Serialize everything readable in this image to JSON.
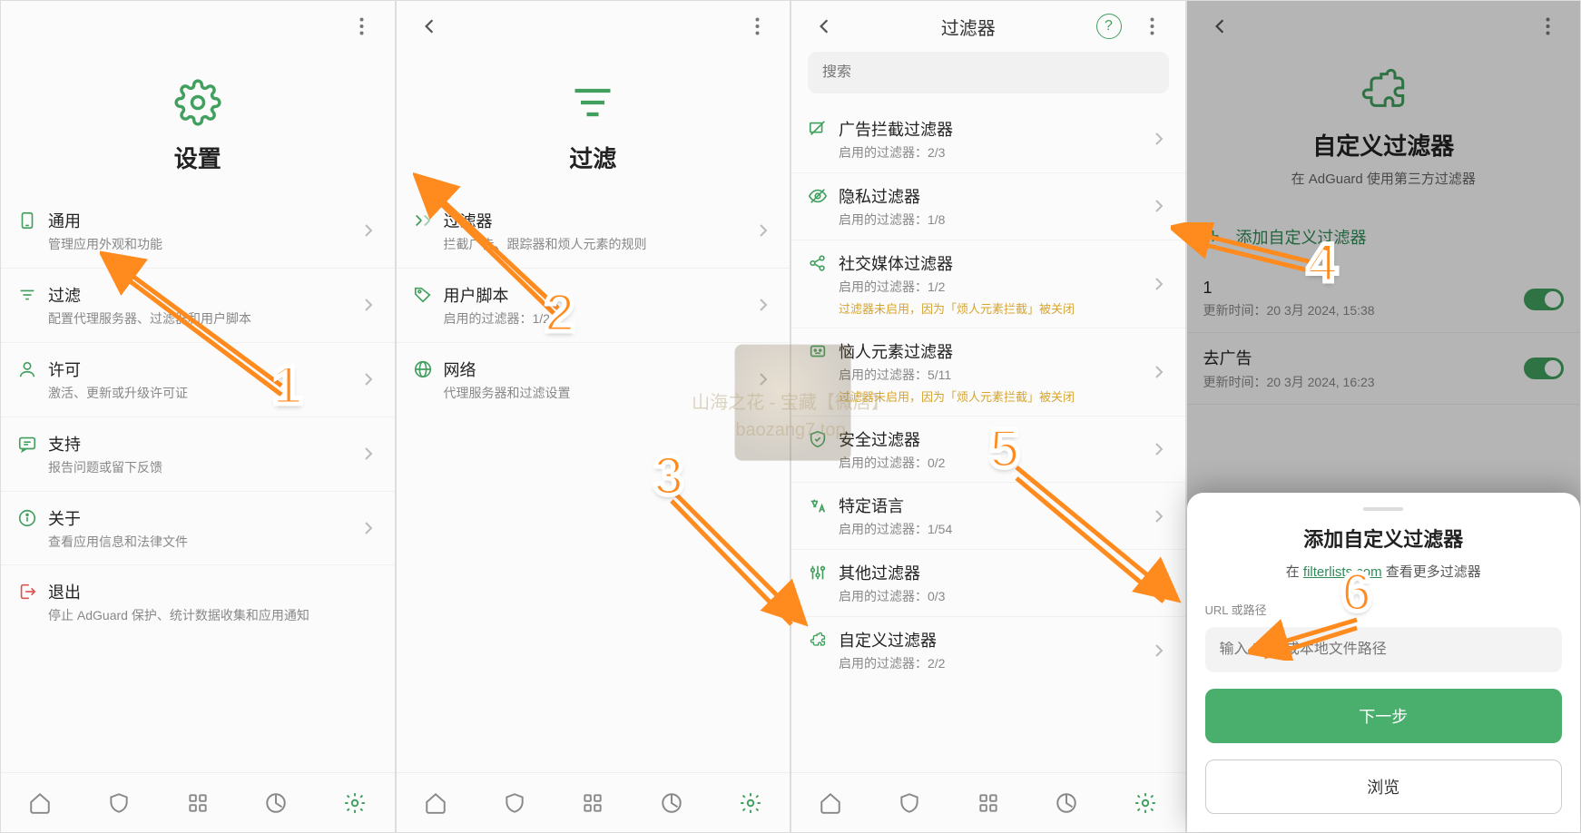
{
  "watermark": {
    "line1": "山海之花 - 宝藏【微店】",
    "line2": "baozang7.top"
  },
  "annotations": {
    "n1": "1",
    "n2": "2",
    "n3": "3",
    "n4": "4",
    "n5": "5",
    "n6": "6"
  },
  "pane1": {
    "hero_title": "设置",
    "items": [
      {
        "title": "通用",
        "sub": "管理应用外观和功能"
      },
      {
        "title": "过滤",
        "sub": "配置代理服务器、过滤器和用户脚本"
      },
      {
        "title": "许可",
        "sub": "激活、更新或升级许可证"
      },
      {
        "title": "支持",
        "sub": "报告问题或留下反馈"
      },
      {
        "title": "关于",
        "sub": "查看应用信息和法律文件"
      },
      {
        "title": "退出",
        "sub": "停止 AdGuard 保护、统计数据收集和应用通知"
      }
    ]
  },
  "pane2": {
    "hero_title": "过滤",
    "items": [
      {
        "title": "过滤器",
        "sub": "拦截广告、跟踪器和烦人元素的规则"
      },
      {
        "title": "用户脚本",
        "sub": "启用的过滤器：1/2"
      },
      {
        "title": "网络",
        "sub": "代理服务器和过滤设置"
      }
    ]
  },
  "pane3": {
    "title": "过滤器",
    "search_placeholder": "搜索",
    "items": [
      {
        "title": "广告拦截过滤器",
        "sub": "启用的过滤器：2/3"
      },
      {
        "title": "隐私过滤器",
        "sub": "启用的过滤器：1/8"
      },
      {
        "title": "社交媒体过滤器",
        "sub": "启用的过滤器：1/2",
        "warn": "过滤器未启用，因为「烦人元素拦截」被关闭"
      },
      {
        "title": "恼人元素过滤器",
        "sub": "启用的过滤器：5/11",
        "warn": "过滤器未启用，因为「烦人元素拦截」被关闭"
      },
      {
        "title": "安全过滤器",
        "sub": "启用的过滤器：0/2"
      },
      {
        "title": "特定语言",
        "sub": "启用的过滤器：1/54"
      },
      {
        "title": "其他过滤器",
        "sub": "启用的过滤器：0/3"
      },
      {
        "title": "自定义过滤器",
        "sub": "启用的过滤器：2/2"
      }
    ]
  },
  "pane4": {
    "hero_title": "自定义过滤器",
    "hero_sub": "在 AdGuard 使用第三方过滤器",
    "add_label": "添加自定义过滤器",
    "filters": [
      {
        "name": "1",
        "time": "更新时间：20 3月 2024, 15:38"
      },
      {
        "name": "去广告",
        "time": "更新时间：20 3月 2024, 16:23"
      }
    ],
    "sheet": {
      "title": "添加自定义过滤器",
      "hint_prefix": "在 ",
      "hint_link": "filterlists.com",
      "hint_suffix": " 查看更多过滤器",
      "field_label": "URL 或路径",
      "field_placeholder": "输入 URL 或本地文件路径",
      "btn_next": "下一步",
      "btn_browse": "浏览"
    }
  }
}
